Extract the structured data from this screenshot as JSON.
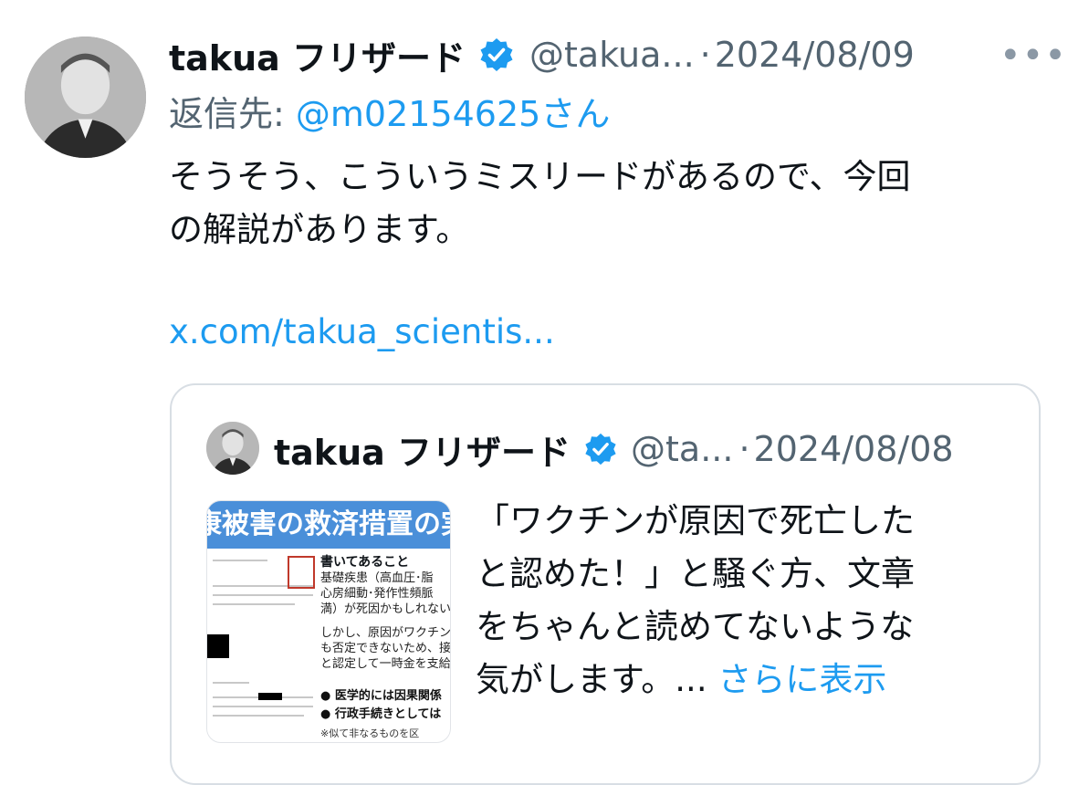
{
  "tweet": {
    "author_name": "takua フリザード",
    "handle": "@takua...",
    "separator": "·",
    "date": "2024/08/09",
    "more_glyph": "•••",
    "reply_prefix": "返信先: ",
    "reply_mention": "@m02154625さん",
    "body_line1": "そうそう、こういうミスリードがあるので、今回",
    "body_line2": "の解説があります。",
    "link": "x.com/takua_scientis..."
  },
  "quote": {
    "author_name": "takua フリザード",
    "handle": "@ta...",
    "separator": "·",
    "date": "2024/08/08",
    "text_line1": "「ワクチンが原因で死亡した",
    "text_line2": "と認めた！」と騒ぐ方、文章",
    "text_line3": "をちゃんと読めてないような",
    "text_line4": "気がします。...",
    "show_more": "さらに表示",
    "thumbnail": {
      "banner": "康被害の救済措置の実",
      "heading": "書いてあること",
      "p1": "基礎疾患（高血圧･脂",
      "p2": "心房細動･発作性頻脈",
      "p3": "満）が死因かもしれない",
      "p4": "しかし、原因がワクチンの",
      "p5": "も否定できないため、接",
      "p6": "と認定して一時金を支給",
      "b1": "● 医学的には因果関係",
      "b2": "● 行政手続きとしては",
      "note": "※似て非なるものを区"
    }
  },
  "colors": {
    "accent": "#1d9bf0",
    "secondary_text": "#536471",
    "verified_badge": "#1d9bf0"
  },
  "icons": {
    "verified": "verified-badge-icon",
    "more": "more-options-icon"
  }
}
